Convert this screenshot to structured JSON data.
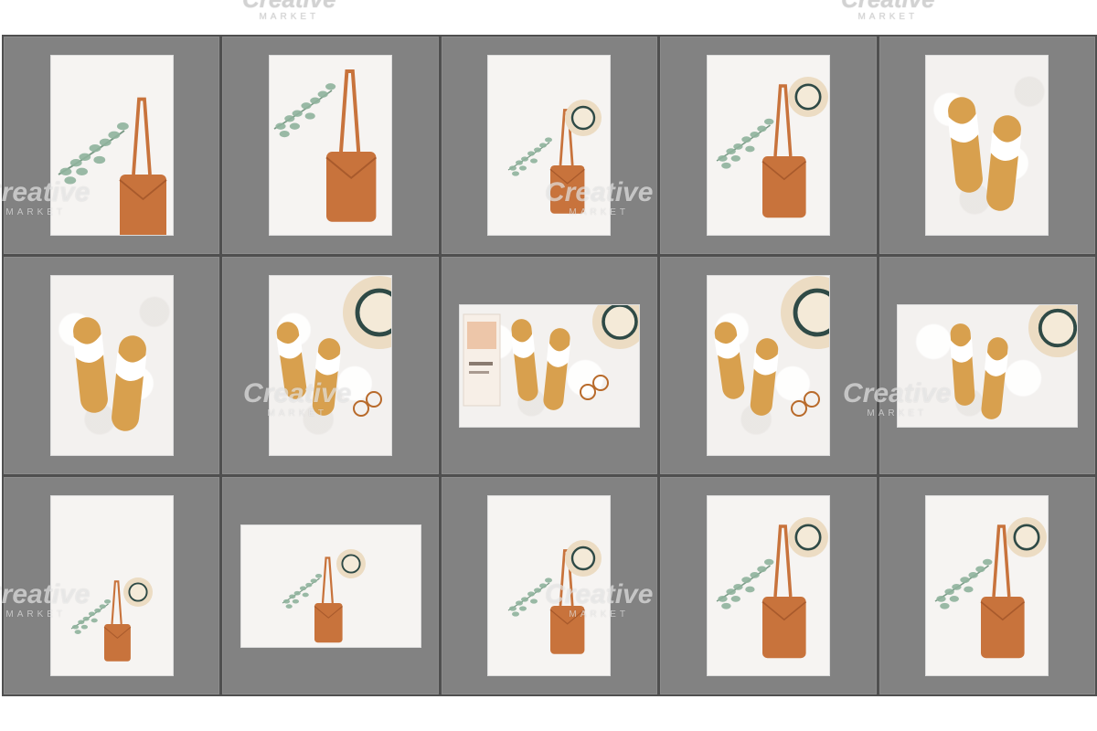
{
  "watermark": {
    "brand": "Creative",
    "tagline": "MARKET"
  },
  "colors": {
    "cell_background": "#828282",
    "grid_lines": "#4f4f4f",
    "leather": "#c8733c",
    "sandal_sole": "#d8a04e",
    "eucalyptus": "#8fb39c",
    "straw_hat": "#ecdcc3"
  },
  "thumbnails": [
    {
      "name": "bag-eucalyptus-closeup",
      "orientation": "portrait",
      "scene": "bag-closeup"
    },
    {
      "name": "bag-eucalyptus-front",
      "orientation": "portrait",
      "scene": "bag-front"
    },
    {
      "name": "bag-with-hat-wall",
      "orientation": "portrait",
      "scene": "bag-hat"
    },
    {
      "name": "bag-with-hat-closeup",
      "orientation": "portrait",
      "scene": "bag-hat-close"
    },
    {
      "name": "sandals-on-fur",
      "orientation": "portrait",
      "scene": "sandals"
    },
    {
      "name": "sandals-on-fur-top",
      "orientation": "portrait",
      "scene": "sandals"
    },
    {
      "name": "sandals-hat-glasses",
      "orientation": "portrait",
      "scene": "sandals-hat-glasses"
    },
    {
      "name": "sandals-magazine-hat-glasses",
      "orientation": "landscape",
      "scene": "sandals-magazine"
    },
    {
      "name": "sandals-hat-glasses-alt",
      "orientation": "portrait",
      "scene": "sandals-hat-glasses"
    },
    {
      "name": "sandals-hat-landscape",
      "orientation": "landscape",
      "scene": "sandals-hat"
    },
    {
      "name": "bag-hat-minimal",
      "orientation": "portrait",
      "scene": "bag-hat-small"
    },
    {
      "name": "bag-hat-landscape",
      "orientation": "landscape",
      "scene": "bag-hat-small"
    },
    {
      "name": "bag-hat-wall-alt",
      "orientation": "portrait",
      "scene": "bag-hat"
    },
    {
      "name": "bag-eucalyptus-blur",
      "orientation": "portrait",
      "scene": "bag-hat-close"
    },
    {
      "name": "bag-eucalyptus-blur-alt",
      "orientation": "portrait",
      "scene": "bag-hat-close"
    }
  ]
}
